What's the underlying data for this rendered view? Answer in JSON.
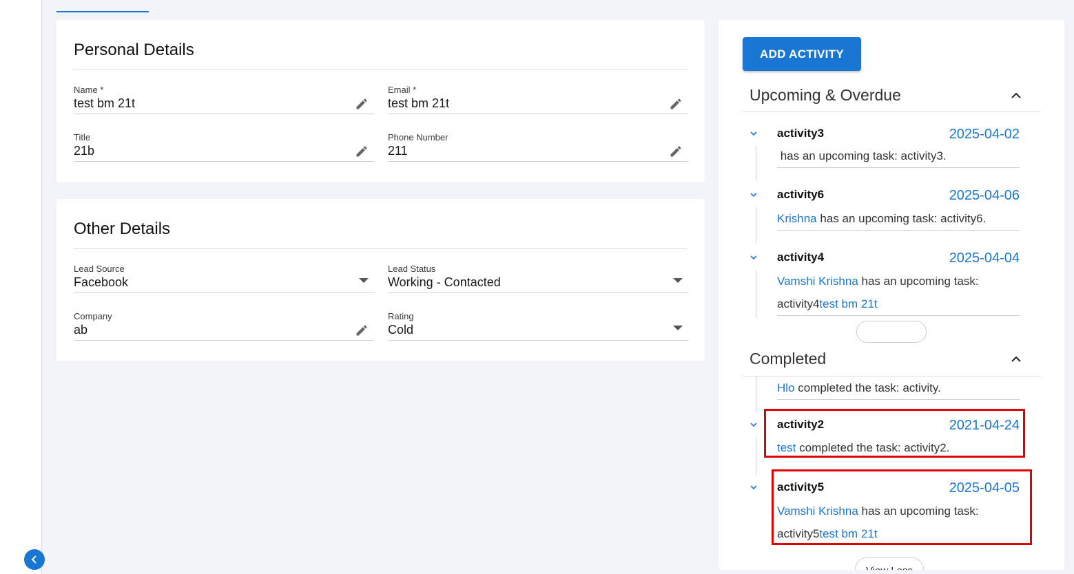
{
  "personal": {
    "title": "Personal Details",
    "name_label": "Name *",
    "name_value": "test bm 21t",
    "email_label": "Email *",
    "email_value": "test bm 21t",
    "title_label": "Title",
    "title_value": "21b",
    "phone_label": "Phone Number",
    "phone_value": "211"
  },
  "other": {
    "title": "Other Details",
    "lead_source_label": "Lead Source",
    "lead_source_value": "Facebook",
    "lead_status_label": "Lead Status",
    "lead_status_value": "Working - Contacted",
    "company_label": "Company",
    "company_value": "ab",
    "rating_label": "Rating",
    "rating_value": "Cold"
  },
  "activity": {
    "add_button": "ADD ACTIVITY",
    "upcoming_title": "Upcoming & Overdue",
    "completed_title": "Completed",
    "view_less": "View Less",
    "upcoming": [
      {
        "name": "activity3",
        "date": "2025-04-02",
        "text": " has an upcoming task: activity3."
      },
      {
        "name": "activity6",
        "date": "2025-04-06",
        "user": "Krishna",
        "text": " has an upcoming task: activity6."
      },
      {
        "name": "activity4",
        "date": "2025-04-04",
        "user": "Vamshi Krishna",
        "text": " has an upcoming task: activity4",
        "link2": "test bm 21t"
      }
    ],
    "completed_partial": {
      "user": "Hlo",
      "text": " completed the task: activity."
    },
    "completed": [
      {
        "name": "activity2",
        "date": "2021-04-24",
        "user": "test",
        "text": " completed the task: activity2."
      },
      {
        "name": "activity5",
        "date": "2025-04-05",
        "user": "Vamshi Krishna",
        "text": " has an upcoming task: activity5",
        "link2": "test bm 21t"
      }
    ]
  },
  "colors": {
    "accent": "#1976d2",
    "highlight": "#e00000",
    "background": "#f3f4f9"
  },
  "icons": {
    "edit": "pencil-icon",
    "dropdown": "caret-down-icon",
    "expand": "chevron-down-icon",
    "collapse": "chevron-up-icon",
    "sidebar_toggle": "chevron-left-icon"
  }
}
